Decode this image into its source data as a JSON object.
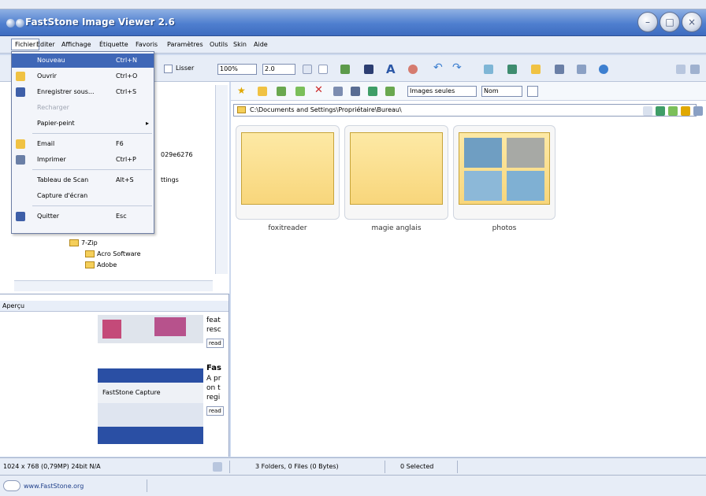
{
  "window": {
    "title": "FastStone Image Viewer 2.6"
  },
  "menubar": [
    "Fichier",
    "Editer",
    "Affichage",
    "Étiquette",
    "Favoris",
    "Paramètres",
    "Outils",
    "Skin",
    "Aide"
  ],
  "toolbar": {
    "lisser": "Lisser",
    "zoom": "100%",
    "ratio": "2.0"
  },
  "file_menu": [
    {
      "label": "Nouveau",
      "shortcut": "Ctrl+N",
      "state": "highlighted"
    },
    {
      "label": "Ouvrir",
      "shortcut": "Ctrl+O"
    },
    {
      "label": "Enregistrer sous...",
      "shortcut": "Ctrl+S"
    },
    {
      "label": "Recharger",
      "shortcut": "",
      "state": "disabled"
    },
    {
      "label": "Papier-peint",
      "shortcut": "",
      "submenu": true
    },
    {
      "label": "Email",
      "shortcut": "F6"
    },
    {
      "label": "Imprimer",
      "shortcut": "Ctrl+P"
    },
    {
      "label": "Tableau de Scan",
      "shortcut": "Alt+S"
    },
    {
      "label": "Capture d'écran",
      "shortcut": ""
    },
    {
      "label": "Quitter",
      "shortcut": "Esc"
    }
  ],
  "tree": {
    "partials": [
      "029e6276",
      "ttings"
    ],
    "items": [
      "7-Zip",
      "Acro Software",
      "Adobe"
    ]
  },
  "preview": {
    "header": "Aperçu",
    "text1": "feat",
    "text2": "resc",
    "read": "read",
    "heading": "Fas",
    "text3": "A pr",
    "text4": "on t",
    "text5": "regi",
    "capture": "FastStone Capture"
  },
  "browser": {
    "filter": "Images seules",
    "sort": "Nom",
    "path": "C:\\Documents and Settings\\Propriétaire\\Bureau\\",
    "items": [
      {
        "label": "foxitreader"
      },
      {
        "label": "magie anglais"
      },
      {
        "label": "photos"
      }
    ]
  },
  "status": {
    "resolution": "1024 x 768 (0,79MP)  24bit N/A",
    "counts": "3 Folders, 0 Files (0 Bytes)",
    "selected": "0 Selected"
  },
  "bottom": {
    "site": "www.FastStone.org"
  }
}
